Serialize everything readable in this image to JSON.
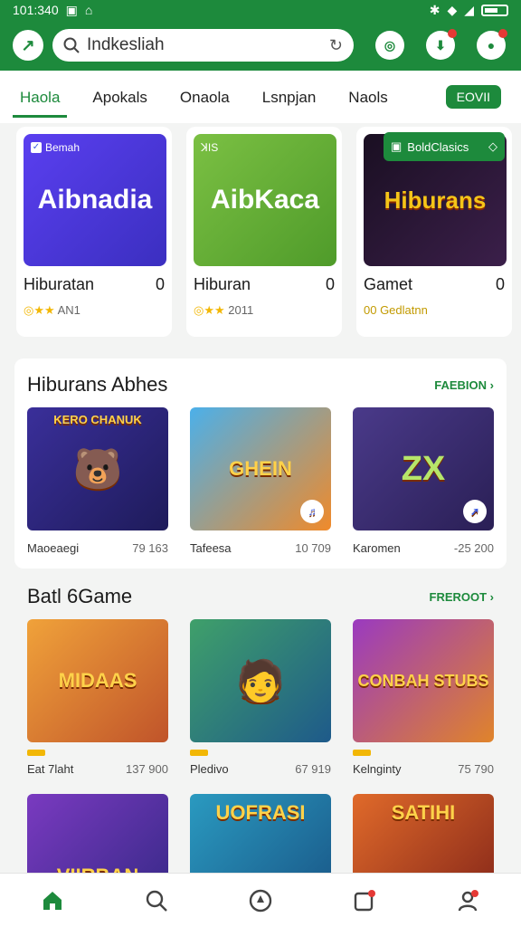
{
  "status": {
    "time": "101:340"
  },
  "search": {
    "value": "Indkesliah"
  },
  "tabs": [
    {
      "label": "Haola",
      "active": true
    },
    {
      "label": "Apokals"
    },
    {
      "label": "Onaola"
    },
    {
      "label": "Lsnpjan"
    },
    {
      "label": "Naols"
    }
  ],
  "tab_badge": "EOVII",
  "featured": [
    {
      "title": "Hiburatan",
      "count": "0",
      "image_text": "Aibnadia",
      "tag": "Bemah",
      "rating_text": "AN1",
      "subtitle": "",
      "color": "#4d3fe0"
    },
    {
      "title": "Hiburan",
      "count": "0",
      "image_text": "AibKaca",
      "tag": "ꓘIS",
      "rating_text": "2011",
      "subtitle": "",
      "color": "#6cb33a"
    },
    {
      "title": "Gamet",
      "count": "0",
      "image_text": "Hiburans",
      "tag": "",
      "rating_text": "",
      "subtitle": "00 Gedlatnn",
      "color": "#2a1636",
      "overlay": "BoldClasics"
    }
  ],
  "section1": {
    "title": "Hiburans Abhes",
    "more": "FAEBION ›",
    "items": [
      {
        "name": "Maoeaegi",
        "num": "79 163",
        "image_text": "KERO CHANUK",
        "color": "#2d2a7a"
      },
      {
        "name": "Tafeesa",
        "num": "10 709",
        "image_text": "GHEIN",
        "color": "#3aa0e0"
      },
      {
        "name": "Karomen",
        "num": "-25 200",
        "image_text": "ZX",
        "color": "#3b2d6a"
      }
    ]
  },
  "section2": {
    "title": "Batl 6Game",
    "more": "FREROOT ›",
    "items": [
      {
        "name": "Eat 7laht",
        "num": "137 900",
        "image_text": "MIDAAS",
        "color": "#e2842a"
      },
      {
        "name": "Pledivo",
        "num": "67 919",
        "image_text": "",
        "color": "#2d8a6a"
      },
      {
        "name": "Kelnginty",
        "num": "75 790",
        "image_text": "CONBAH STUBS",
        "color": "#8a3aa8"
      }
    ],
    "row2": [
      {
        "image_text": "VIIRBAN",
        "color": "#6a3ab0"
      },
      {
        "image_text": "UOFRASI",
        "color": "#2a8ab0"
      },
      {
        "image_text": "SATIHI",
        "color": "#c0542a"
      }
    ]
  }
}
